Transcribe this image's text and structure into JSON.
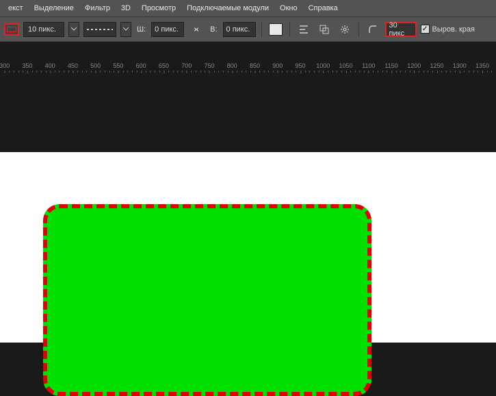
{
  "menu": {
    "items": [
      "екст",
      "Выделение",
      "Фильтр",
      "3D",
      "Просмотр",
      "Подключаемые модули",
      "Окно",
      "Справка"
    ]
  },
  "options": {
    "strokeWidth": "10 пикс.",
    "wLabel": "Ш:",
    "wValue": "0 пикс.",
    "hLabel": "В:",
    "hValue": "0 пикс.",
    "radiusValue": "30 пикс",
    "alignEdgesLabel": "Выров. края"
  },
  "ruler": {
    "majorTicks": [
      300,
      350,
      400,
      450,
      500,
      550,
      600,
      650,
      700,
      750,
      800,
      850,
      900,
      950,
      1000,
      1050,
      1100,
      1150,
      1200,
      1250,
      1300,
      1350
    ]
  }
}
